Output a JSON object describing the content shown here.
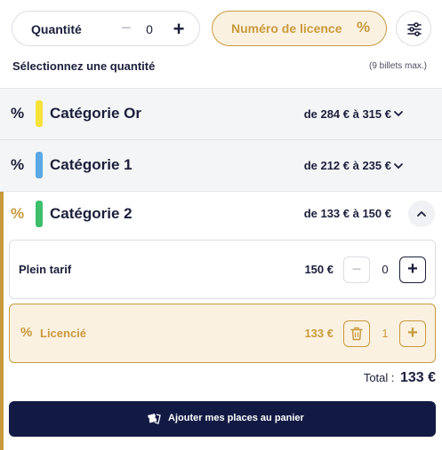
{
  "quantity": {
    "label": "Quantité",
    "minus": "−",
    "value": "0",
    "plus": "+"
  },
  "licence_button": {
    "label": "Numéro de licence",
    "icon": "%"
  },
  "filter_button": {
    "icon": "sliders-icon"
  },
  "hint": {
    "select": "Sélectionnez une quantité",
    "max": "(9 billets max.)"
  },
  "categories": [
    {
      "pct": "%",
      "name": "Catégorie Or",
      "price": "de 284 € à 315 €",
      "color": "#f7e23a",
      "expanded": false
    },
    {
      "pct": "%",
      "name": "Catégorie 1",
      "price": "de 212 € à 235 €",
      "color": "#5aa8e6",
      "expanded": false
    },
    {
      "pct": "%",
      "name": "Catégorie 2",
      "price": "de 133 € à 150 €",
      "color": "#3dbf6b",
      "expanded": true
    }
  ],
  "tickets": [
    {
      "name": "Plein tarif",
      "price": "150 €",
      "minus": "−",
      "count": "0",
      "plus": "+"
    },
    {
      "pct": "%",
      "name": "Licencié",
      "price": "133 €",
      "count": "1",
      "plus": "+"
    }
  ],
  "total": {
    "label": "Total :",
    "value": "133 €"
  },
  "cta": {
    "label": "Ajouter mes places au panier",
    "icon": "tickets-icon"
  },
  "colors": {
    "accent": "#c89a3c",
    "accent_bg": "#fbf1e1",
    "navy": "#121a44",
    "text": "#1b1f3b"
  }
}
